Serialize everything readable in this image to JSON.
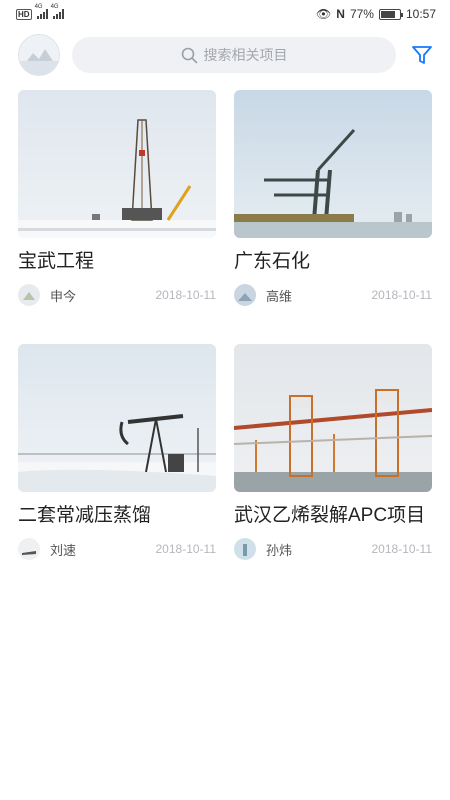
{
  "status_bar": {
    "network_left": "4G",
    "network_right": "4G",
    "battery": "77%",
    "time": "10:57"
  },
  "header": {
    "search_placeholder": "搜索相关项目"
  },
  "projects": [
    {
      "title": "宝武工程",
      "author": "申今",
      "date": "2018-10-11"
    },
    {
      "title": "广东石化",
      "author": "高维",
      "date": "2018-10-11"
    },
    {
      "title": "二套常减压蒸馏",
      "author": "刘速",
      "date": "2018-10-11"
    },
    {
      "title": "武汉乙烯裂解APC项目",
      "author": "孙炜",
      "date": "2018-10-11"
    }
  ],
  "colors": {
    "accent": "#1677ff",
    "search_bg": "#f0f1f4",
    "date_text": "#b4b7bc"
  },
  "icons": {
    "search": "search-icon",
    "filter": "filter-icon"
  }
}
